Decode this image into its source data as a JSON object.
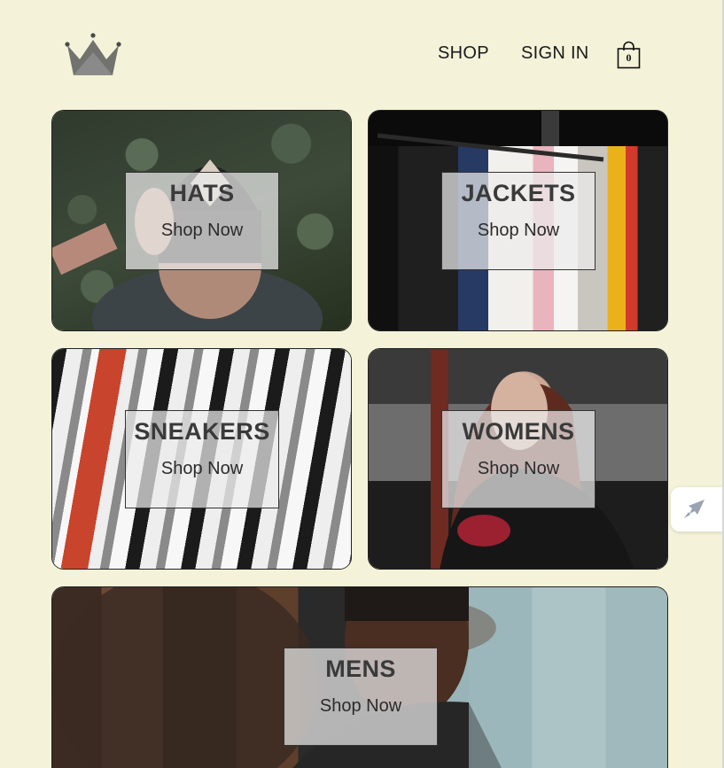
{
  "header": {
    "logo_icon": "crown-icon",
    "nav": {
      "shop_label": "SHOP",
      "signin_label": "SIGN IN"
    },
    "cart": {
      "icon": "shopping-bag-icon",
      "count": "0"
    }
  },
  "categories": [
    {
      "title": "HATS",
      "cta": "Shop Now"
    },
    {
      "title": "JACKETS",
      "cta": "Shop Now"
    },
    {
      "title": "SNEAKERS",
      "cta": "Shop Now"
    },
    {
      "title": "WOMENS",
      "cta": "Shop Now"
    },
    {
      "title": "MENS",
      "cta": "Shop Now"
    }
  ],
  "floating_button": {
    "icon": "rocket-icon"
  },
  "colors": {
    "background": "#f4f3d9",
    "overlay": "#ececec",
    "text": "#3a3a3a"
  }
}
